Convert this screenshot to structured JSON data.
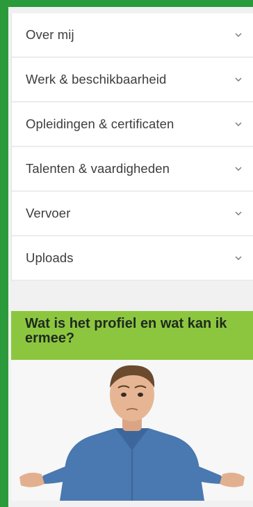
{
  "accordion": {
    "items": [
      {
        "label": "Over mij"
      },
      {
        "label": "Werk & beschikbaarheid"
      },
      {
        "label": "Opleidingen & certificaten"
      },
      {
        "label": "Talenten & vaardigheden"
      },
      {
        "label": "Vervoer"
      },
      {
        "label": "Uploads"
      }
    ],
    "chevron_icon": "chevron-down-icon"
  },
  "promo": {
    "title": "Wat is het profiel en wat kan ik ermee?",
    "image": "person-shrugging-photo"
  },
  "colors": {
    "frame_green": "#2a9a3a",
    "promo_green": "#8cc63f",
    "text": "#3d3d3d"
  }
}
